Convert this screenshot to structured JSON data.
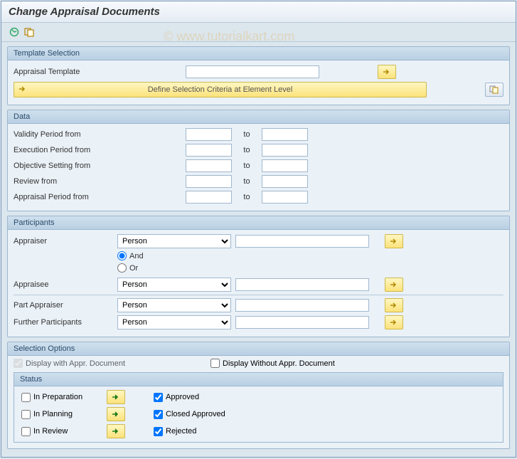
{
  "window": {
    "title": "Change Appraisal Documents"
  },
  "watermark": "© www.tutorialkart.com",
  "groups": {
    "template": {
      "title": "Template Selection",
      "apprTemplate": "Appraisal Template",
      "defineBtn": "Define Selection Criteria at Element Level"
    },
    "data": {
      "title": "Data",
      "validity": "Validity Period from",
      "execution": "Execution Period from",
      "objective": "Objective Setting from",
      "review": "Review from",
      "appraisalP": "Appraisal Period from",
      "to": "to"
    },
    "participants": {
      "title": "Participants",
      "appraiser": "Appraiser",
      "appraisee": "Appraisee",
      "partAppraiser": "Part Appraiser",
      "furtherP": "Further Participants",
      "and": "And",
      "or": "Or",
      "personOpt": "Person"
    },
    "selOptions": {
      "title": "Selection Options",
      "withDoc": "Display with Appr. Document",
      "withoutDoc": "Display Without Appr. Document",
      "statusTitle": "Status",
      "inPrep": "In Preparation",
      "inPlan": "In Planning",
      "inReview": "In Review",
      "approved": "Approved",
      "closedApproved": "Closed Approved",
      "rejected": "Rejected"
    }
  }
}
